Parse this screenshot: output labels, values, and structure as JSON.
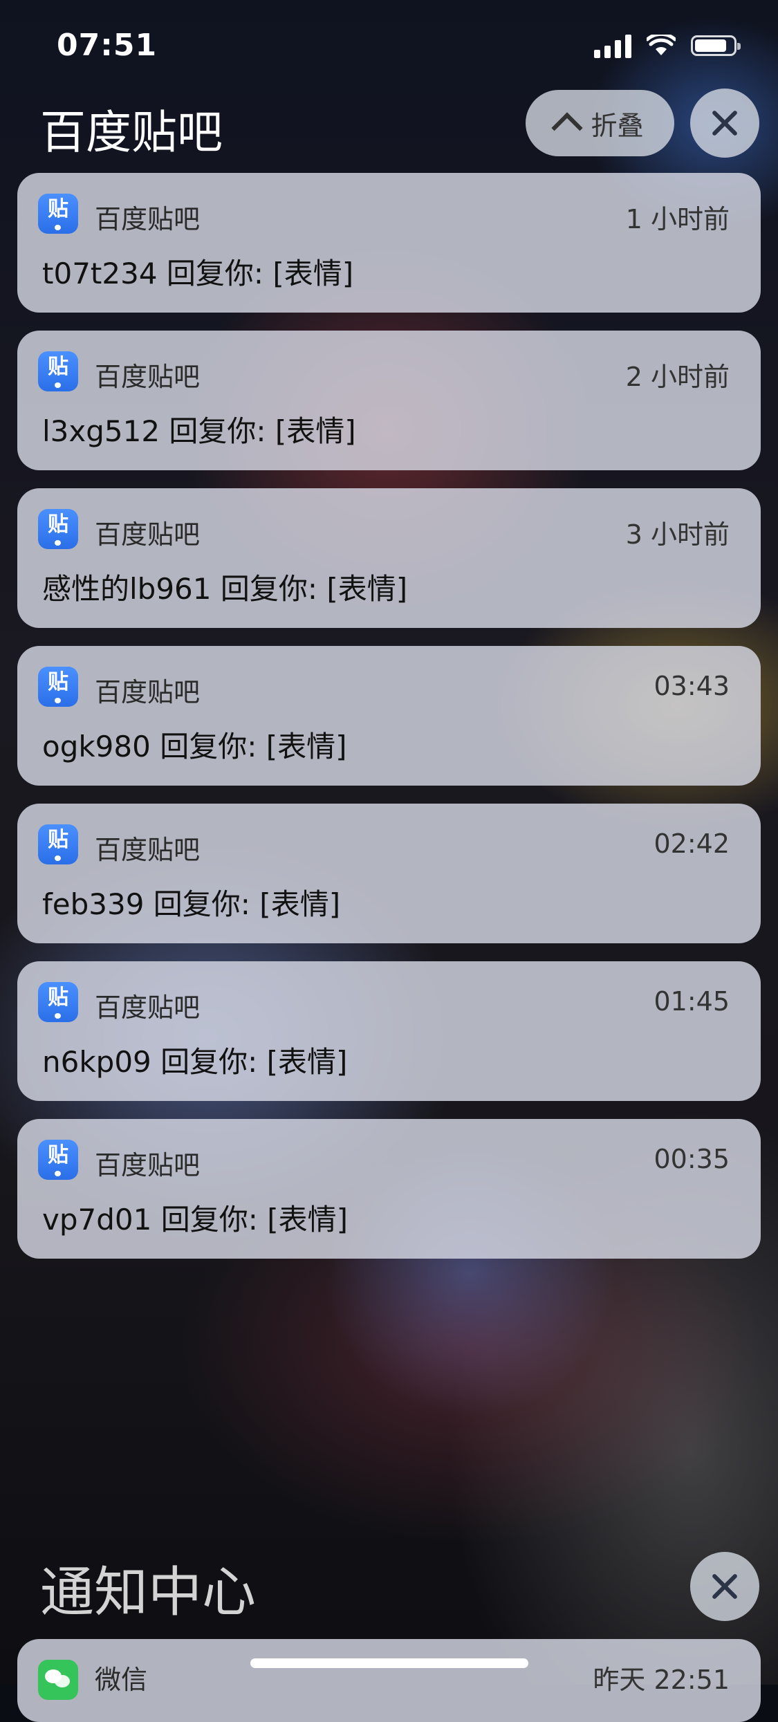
{
  "status_bar": {
    "time": "07:51",
    "battery_level": 0.85
  },
  "group": {
    "title": "百度贴吧",
    "collapse_label": "折叠"
  },
  "notifications": [
    {
      "app": "百度贴吧",
      "time": "1 小时前",
      "text": "t07t234 回复你: [表情]"
    },
    {
      "app": "百度贴吧",
      "time": "2 小时前",
      "text": "l3xg512 回复你: [表情]"
    },
    {
      "app": "百度贴吧",
      "time": "3 小时前",
      "text": "感性的lb961 回复你: [表情]"
    },
    {
      "app": "百度贴吧",
      "time": "03:43",
      "text": "ogk980 回复你: [表情]"
    },
    {
      "app": "百度贴吧",
      "time": "02:42",
      "text": "feb339 回复你: [表情]"
    },
    {
      "app": "百度贴吧",
      "time": "01:45",
      "text": "n6kp09 回复你: [表情]"
    },
    {
      "app": "百度贴吧",
      "time": "00:35",
      "text": "vp7d01 回复你: [表情]"
    }
  ],
  "app_icon": {
    "glyph": "贴",
    "color": "#3a82f7",
    "icon": "tieba-icon"
  },
  "notification_center": {
    "title": "通知中心"
  },
  "bottom_notification": {
    "app": "微信",
    "time": "昨天 22:51",
    "icon": "wechat-icon",
    "color": "#35c45a"
  }
}
